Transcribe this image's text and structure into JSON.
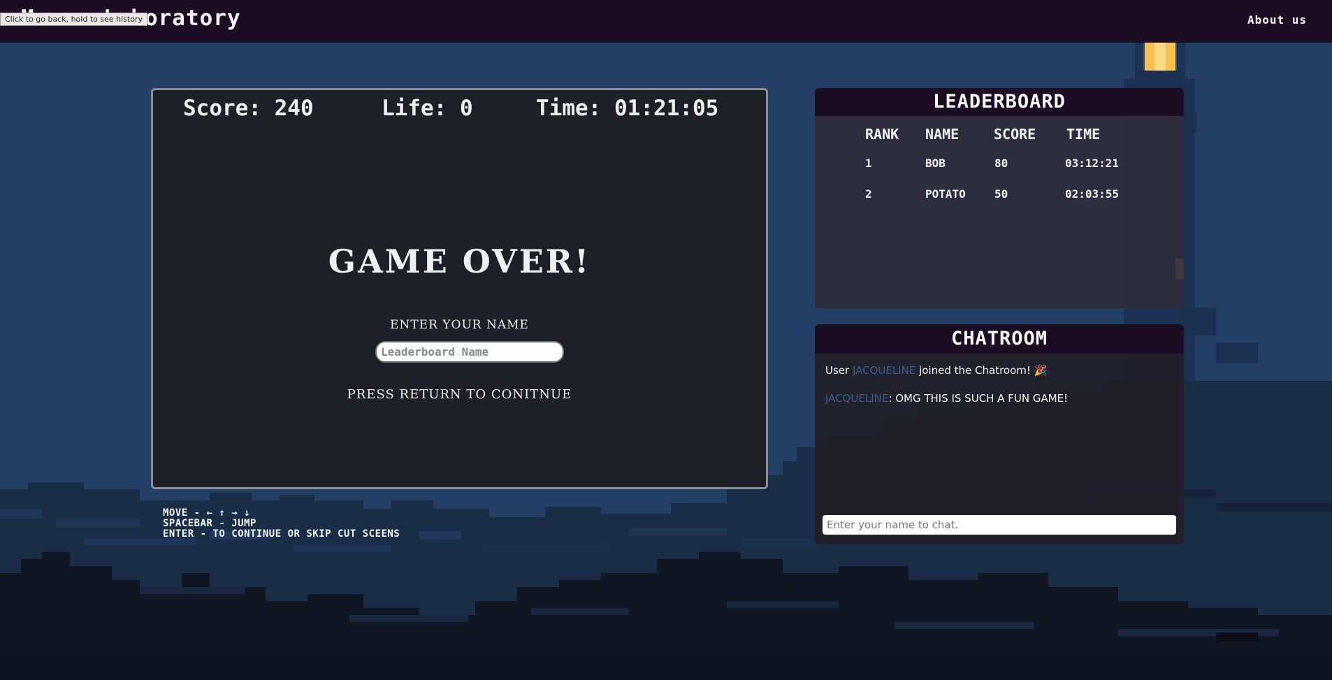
{
  "header": {
    "site_title": "Mouse Laboratory",
    "about_link": "About us",
    "back_tooltip": "Click to go back, hold to see history"
  },
  "game": {
    "hud": {
      "score": "Score: 240",
      "life": "Life: 0",
      "time": "Time: 01:21:05"
    },
    "game_over": "GAME OVER!",
    "enter_name_label": "ENTER YOUR NAME",
    "name_placeholder": "Leaderboard Name",
    "press_return": "PRESS RETURN TO CONITNUE"
  },
  "controls": {
    "move": "MOVE - ← ↑ → ↓",
    "jump": "SPACEBAR - JUMP",
    "enter": "ENTER - TO CONTINUE OR SKIP CUT SCEENS"
  },
  "leaderboard": {
    "title": "LEADERBOARD",
    "columns": [
      "RANK",
      "NAME",
      "SCORE",
      "TIME"
    ],
    "rows": [
      {
        "rank": "1",
        "name": "BOB",
        "score": "80",
        "time": "03:12:21"
      },
      {
        "rank": "2",
        "name": "POTATO",
        "score": "50",
        "time": "02:03:55"
      }
    ]
  },
  "chatroom": {
    "title": "CHATROOM",
    "messages": [
      {
        "prefix": "User ",
        "user": "JACQUELINE",
        "text": " joined the Chatroom! 🎉"
      },
      {
        "prefix": "",
        "user": "JACQUELINE",
        "text": ": OMG THIS IS SUCH A FUN GAME!"
      }
    ],
    "input_placeholder": "Enter your name to chat."
  },
  "colors": {
    "topbar": "#1d0d22",
    "sky": "#233f66",
    "panel": "#1e1f27",
    "chat_username": "#3f5d8c",
    "lighthouse_light": "#f7c04f"
  }
}
